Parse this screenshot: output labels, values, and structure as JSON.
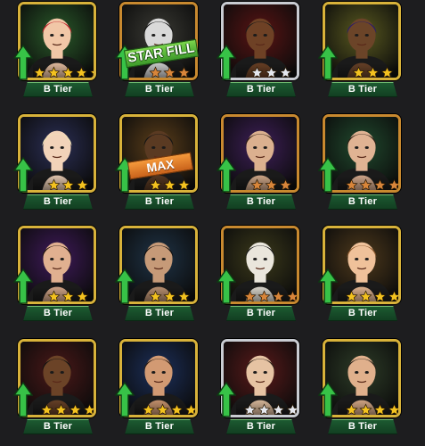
{
  "badge_label": "B Tier",
  "colors": {
    "background": "#1d1d1f",
    "tier_plate": "#1c5a31",
    "up_arrow": "#37c247",
    "star_gold": "#f3c21f",
    "star_bronze": "#d8853a",
    "star_silver": "#e4e7ee",
    "star_empty": "#3b3b3b"
  },
  "icons": {
    "up_arrow": "up-arrow-icon",
    "star": "star-icon",
    "portrait": "wrestler-portrait"
  },
  "cards": [
    {
      "frame": "gold",
      "bg": "#2a5a2a",
      "skin": "#f1c7a7",
      "hair": "#c2202b",
      "stars": 5,
      "filled": 5,
      "star_color": "gold",
      "overlay": null
    },
    {
      "frame": "bronze",
      "bg": "#3a3a34",
      "skin": "#d9d9d9",
      "hair": "#111111",
      "stars": 3,
      "filled": 3,
      "star_color": "bronze",
      "overlay": "STAR FILL"
    },
    {
      "frame": "silver",
      "bg": "#5a1414",
      "skin": "#6e4125",
      "hair": "#1b1b1b",
      "stars": 3,
      "filled": 3,
      "star_color": "silver",
      "overlay": null
    },
    {
      "frame": "gold",
      "bg": "#5a5a20",
      "skin": "#6b4428",
      "hair": "#2a1d6b",
      "stars": 3,
      "filled": 3,
      "star_color": "gold",
      "overlay": null
    },
    {
      "frame": "gold",
      "bg": "#2b2f55",
      "skin": "#f2d3b9",
      "hair": "#f1e4b6",
      "stars": 3,
      "filled": 3,
      "star_color": "gold",
      "overlay": null
    },
    {
      "frame": "gold",
      "bg": "#5b3e1a",
      "skin": "#5a3a22",
      "hair": "#151515",
      "stars": 3,
      "filled": 3,
      "star_color": "gold",
      "overlay": "MAX"
    },
    {
      "frame": "bronze",
      "bg": "#3e1f58",
      "skin": "#dbb08f",
      "hair": "#2a1b12",
      "stars": 3,
      "filled": 3,
      "star_color": "bronze",
      "overlay": null
    },
    {
      "frame": "bronze",
      "bg": "#214a2e",
      "skin": "#e0b393",
      "hair": "#2c1f15",
      "stars": 4,
      "filled": 4,
      "star_color": "bronze",
      "overlay": null
    },
    {
      "frame": "gold",
      "bg": "#3f1a5a",
      "skin": "#e0b090",
      "hair": "#1e130b",
      "stars": 3,
      "filled": 3,
      "star_color": "gold",
      "overlay": null
    },
    {
      "frame": "gold",
      "bg": "#1f3346",
      "skin": "#c69a78",
      "hair": "#0f0f0f",
      "stars": 3,
      "filled": 3,
      "star_color": "gold",
      "overlay": null
    },
    {
      "frame": "bronze",
      "bg": "#3c3a1b",
      "skin": "#eae6dc",
      "hair": "#1a1a1a",
      "stars": 4,
      "filled": 4,
      "star_color": "bronze",
      "overlay": null
    },
    {
      "frame": "gold",
      "bg": "#4f3a1c",
      "skin": "#efc19a",
      "hair": "#8c5a2e",
      "stars": 4,
      "filled": 4,
      "star_color": "gold",
      "overlay": null
    },
    {
      "frame": "gold",
      "bg": "#4a1818",
      "skin": "#6b4327",
      "hair": "#121212",
      "stars": 4,
      "filled": 4,
      "star_color": "gold",
      "overlay": null
    },
    {
      "frame": "gold",
      "bg": "#1c2f5a",
      "skin": "#d29a73",
      "hair": "#2a1d14",
      "stars": 4,
      "filled": 4,
      "star_color": "gold",
      "overlay": null
    },
    {
      "frame": "silver",
      "bg": "#5a1a1a",
      "skin": "#e6c3a3",
      "hair": "#2c1f16",
      "stars": 4,
      "filled": 4,
      "star_color": "silver",
      "overlay": null
    },
    {
      "frame": "gold",
      "bg": "#2e3d28",
      "skin": "#e0b08c",
      "hair": "#2b241b",
      "stars": 4,
      "filled": 4,
      "star_color": "gold",
      "overlay": null
    }
  ]
}
